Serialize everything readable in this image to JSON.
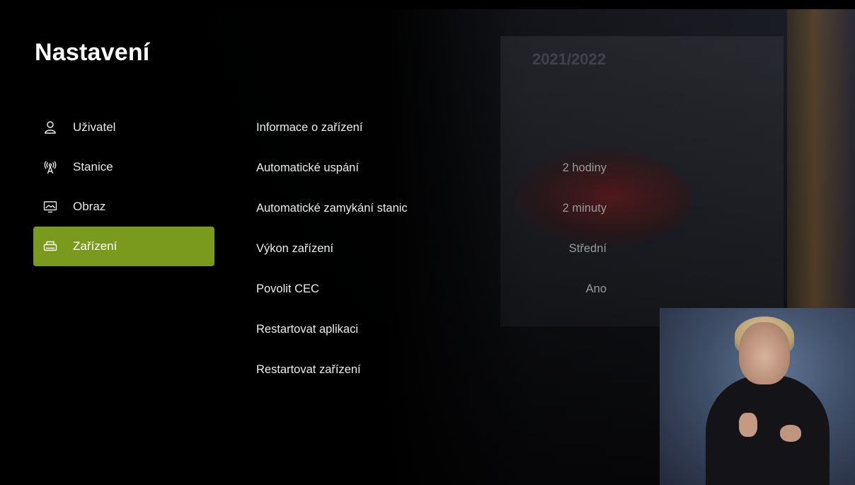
{
  "page": {
    "title": "Nastavení"
  },
  "sidebar": {
    "items": [
      {
        "label": "Uživatel",
        "icon": "user-icon",
        "active": false
      },
      {
        "label": "Stanice",
        "icon": "antenna-icon",
        "active": false
      },
      {
        "label": "Obraz",
        "icon": "picture-icon",
        "active": false
      },
      {
        "label": "Zařízení",
        "icon": "device-icon",
        "active": true
      }
    ]
  },
  "options": {
    "items": [
      {
        "label": "Informace o zařízení",
        "value": ""
      },
      {
        "label": "Automatické uspání",
        "value": "2 hodiny"
      },
      {
        "label": "Automatické zamykání stanic",
        "value": "2 minuty"
      },
      {
        "label": "Výkon zařízení",
        "value": "Střední"
      },
      {
        "label": "Povolit CEC",
        "value": "Ano"
      },
      {
        "label": "Restartovat aplikaci",
        "value": ""
      },
      {
        "label": "Restartovat zařízení",
        "value": ""
      }
    ]
  },
  "background": {
    "slide_title": "2021/2022"
  },
  "colors": {
    "accent": "#7a9a1e",
    "text": "#ffffff",
    "value_text": "#9a9a9a"
  }
}
